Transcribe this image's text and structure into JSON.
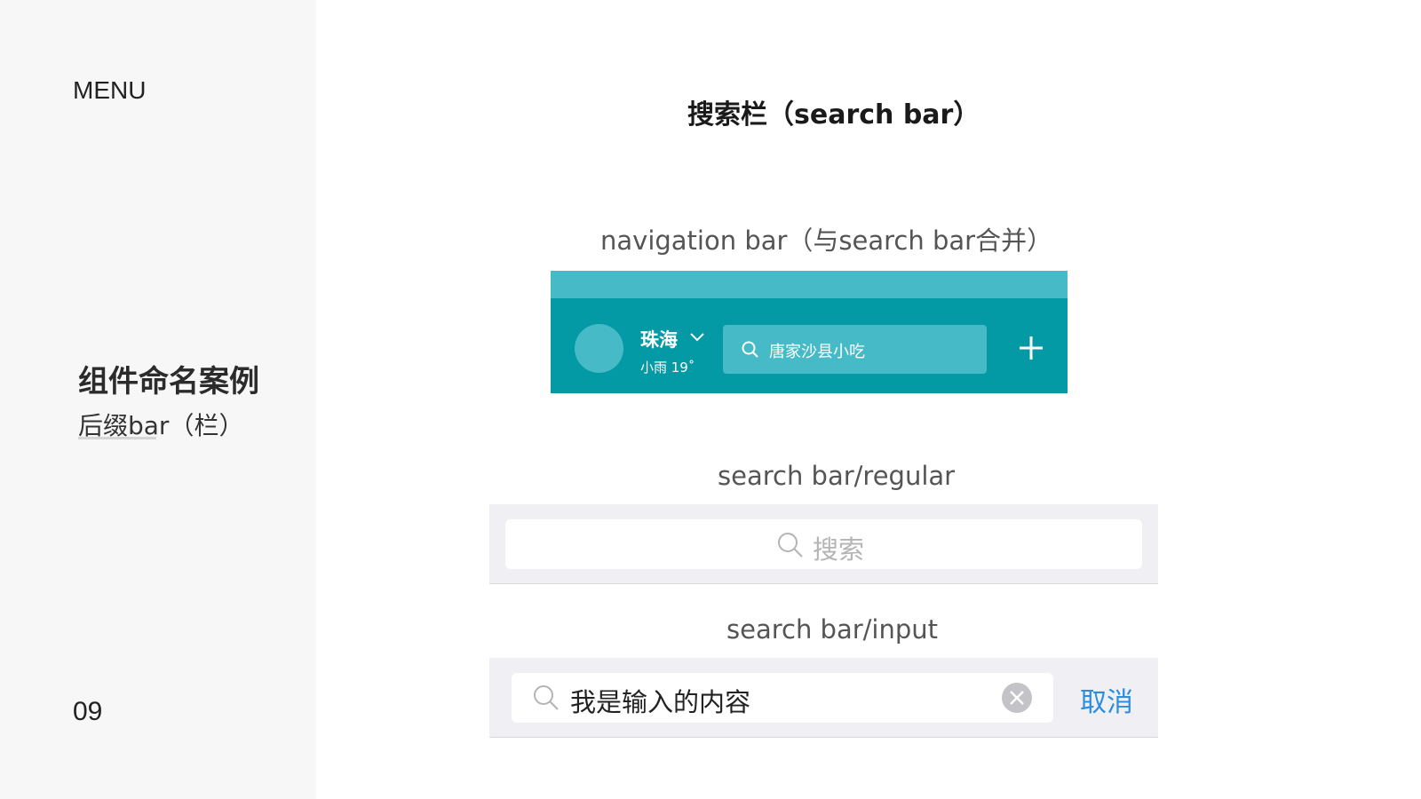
{
  "sidebar": {
    "menu_label": "MENU",
    "section_title": "组件命名案例",
    "section_subtitle": "后缀bar（栏）",
    "page_number": "09"
  },
  "main": {
    "title": "搜索栏（search bar）",
    "captions": {
      "nav": "navigation bar（与search bar合并）",
      "regular": "search bar/regular",
      "input": "search bar/input"
    }
  },
  "navbar_demo": {
    "city": "珠海",
    "weather": "小雨 19˚",
    "search_text": "唐家沙县小吃",
    "icons": [
      "avatar",
      "chevron-down-icon",
      "search-icon",
      "plus-icon"
    ]
  },
  "search_regular": {
    "placeholder": "搜索",
    "icon": "search-icon"
  },
  "search_input": {
    "value": "我是输入的内容",
    "cancel_label": "取消",
    "icons": [
      "search-icon",
      "clear-icon"
    ]
  },
  "colors": {
    "nav_bg": "#0399a5",
    "nav_accent": "#46bac7",
    "search_bg": "#efeff4",
    "cancel_blue": "#2c8de0",
    "sidebar_bg": "#f7f7f7"
  }
}
